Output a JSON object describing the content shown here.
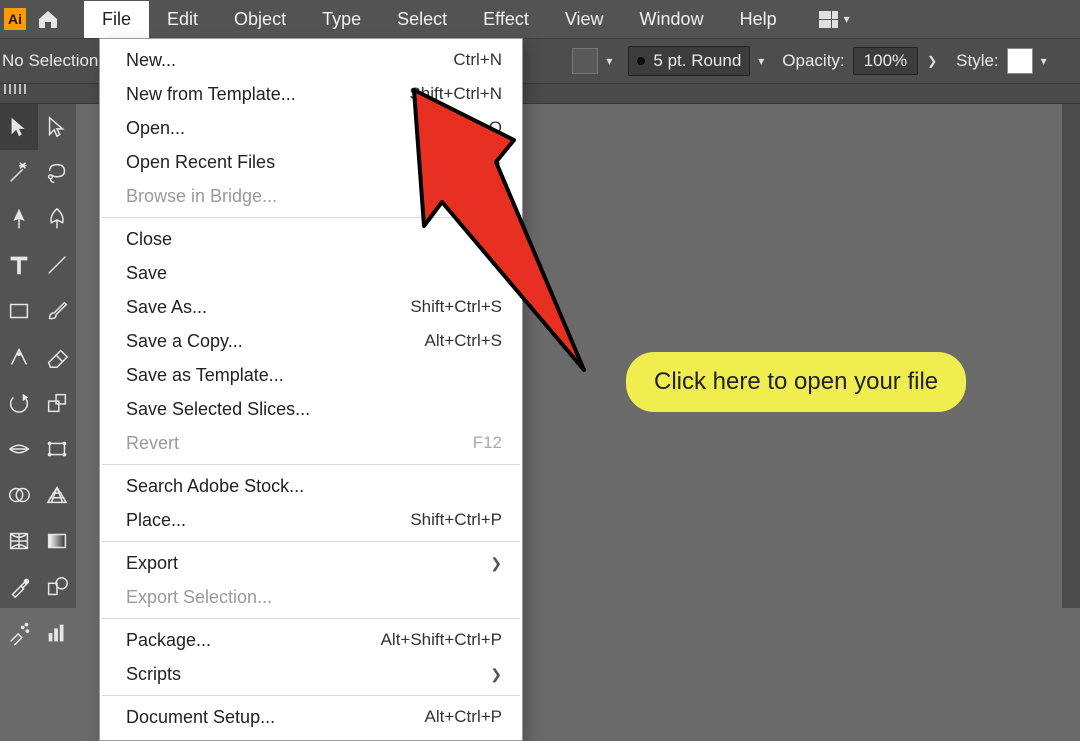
{
  "menubar": {
    "items": [
      "File",
      "Edit",
      "Object",
      "Type",
      "Select",
      "Effect",
      "View",
      "Window",
      "Help"
    ],
    "active_index": 0
  },
  "controlbar": {
    "no_selection_label": "No Selection",
    "stroke_value": "5 pt. Round",
    "opacity_label": "Opacity:",
    "opacity_value": "100%",
    "style_label": "Style:"
  },
  "dropdown": {
    "sections": [
      [
        {
          "label": "New...",
          "shortcut": "Ctrl+N"
        },
        {
          "label": "New from Template...",
          "shortcut": "Shift+Ctrl+N"
        },
        {
          "label": "Open...",
          "shortcut": "Ctrl+O"
        },
        {
          "label": "Open Recent Files",
          "submenu": true
        },
        {
          "label": "Browse in Bridge...",
          "disabled": true
        }
      ],
      [
        {
          "label": "Close"
        },
        {
          "label": "Save"
        },
        {
          "label": "Save As...",
          "shortcut": "Shift+Ctrl+S"
        },
        {
          "label": "Save a Copy...",
          "shortcut": "Alt+Ctrl+S"
        },
        {
          "label": "Save as Template..."
        },
        {
          "label": "Save Selected Slices..."
        },
        {
          "label": "Revert",
          "shortcut": "F12",
          "disabled": true
        }
      ],
      [
        {
          "label": "Search Adobe Stock..."
        },
        {
          "label": "Place...",
          "shortcut": "Shift+Ctrl+P"
        }
      ],
      [
        {
          "label": "Export",
          "submenu": true
        },
        {
          "label": "Export Selection...",
          "disabled": true
        }
      ],
      [
        {
          "label": "Package...",
          "shortcut": "Alt+Shift+Ctrl+P"
        },
        {
          "label": "Scripts",
          "submenu": true
        }
      ],
      [
        {
          "label": "Document Setup...",
          "shortcut": "Alt+Ctrl+P"
        }
      ]
    ]
  },
  "annotation": {
    "text": "Click here to open your file"
  },
  "tools": [
    "selection",
    "direct-selection",
    "magic-wand",
    "lasso",
    "pen",
    "curvature-pen",
    "type",
    "line-segment",
    "rectangle",
    "paintbrush",
    "shaper",
    "eraser",
    "rotate",
    "scale",
    "width",
    "free-transform",
    "shape-builder",
    "perspective-grid",
    "mesh",
    "gradient",
    "eyedropper",
    "blend",
    "symbol-sprayer",
    "column-graph"
  ]
}
